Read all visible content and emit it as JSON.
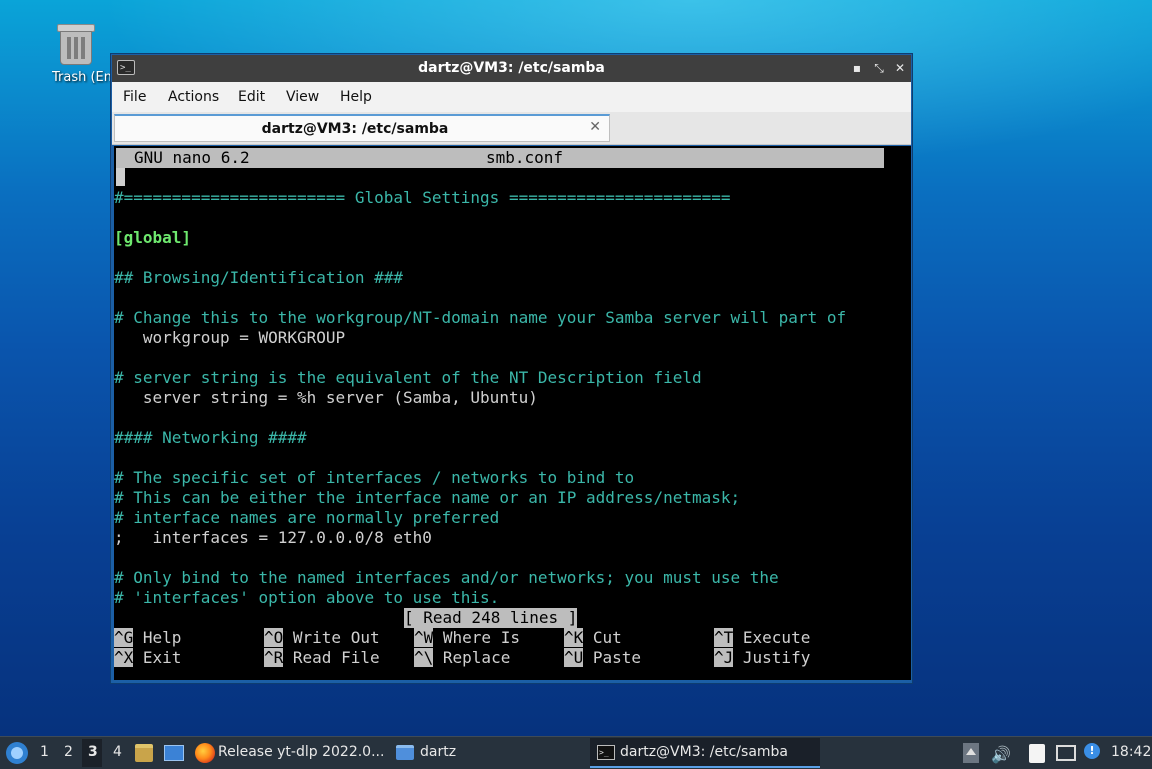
{
  "desktop": {
    "trash_label": "Trash (Empty)"
  },
  "window": {
    "title": "dartz@VM3: /etc/samba",
    "menu": [
      "File",
      "Actions",
      "Edit",
      "View",
      "Help"
    ],
    "tab_title": "dartz@VM3: /etc/samba",
    "controls": {
      "minimize": "▪",
      "maximize": "⤡",
      "close": "✕"
    }
  },
  "nano": {
    "version": "GNU nano 6.2",
    "filename": "smb.conf",
    "lines": [
      {
        "text": "#======================= Global Settings =======================",
        "style": "cyan"
      },
      {
        "text": "",
        "style": "white"
      },
      {
        "text": "[global]",
        "style": "green"
      },
      {
        "text": "",
        "style": "white"
      },
      {
        "text": "## Browsing/Identification ###",
        "style": "cyan"
      },
      {
        "text": "",
        "style": "white"
      },
      {
        "text": "# Change this to the workgroup/NT-domain name your Samba server will part of",
        "style": "cyan"
      },
      {
        "text": "   workgroup = WORKGROUP",
        "style": "white"
      },
      {
        "text": "",
        "style": "white"
      },
      {
        "text": "# server string is the equivalent of the NT Description field",
        "style": "cyan"
      },
      {
        "text": "   server string = %h server (Samba, Ubuntu)",
        "style": "white"
      },
      {
        "text": "",
        "style": "white"
      },
      {
        "text": "#### Networking ####",
        "style": "cyan"
      },
      {
        "text": "",
        "style": "white"
      },
      {
        "text": "# The specific set of interfaces / networks to bind to",
        "style": "cyan"
      },
      {
        "text": "# This can be either the interface name or an IP address/netmask;",
        "style": "cyan"
      },
      {
        "text": "# interface names are normally preferred",
        "style": "cyan"
      },
      {
        "text": ";   interfaces = 127.0.0.0/8 eth0",
        "style": "white"
      },
      {
        "text": "",
        "style": "white"
      },
      {
        "text": "# Only bind to the named interfaces and/or networks; you must use the",
        "style": "cyan"
      },
      {
        "text": "# 'interfaces' option above to use this.",
        "style": "cyan"
      }
    ],
    "status": "[ Read 248 lines ]",
    "shortcuts": [
      [
        {
          "key": "^G",
          "label": "Help"
        },
        {
          "key": "^O",
          "label": "Write Out"
        },
        {
          "key": "^W",
          "label": "Where Is"
        },
        {
          "key": "^K",
          "label": "Cut"
        },
        {
          "key": "^T",
          "label": "Execute"
        }
      ],
      [
        {
          "key": "^X",
          "label": "Exit"
        },
        {
          "key": "^R",
          "label": "Read File"
        },
        {
          "key": "^\\",
          "label": "Replace"
        },
        {
          "key": "^U",
          "label": "Paste"
        },
        {
          "key": "^J",
          "label": "Justify"
        }
      ]
    ]
  },
  "taskbar": {
    "workspaces": [
      "1",
      "2",
      "3",
      "4"
    ],
    "tasks": {
      "firefox": "Release yt-dlp 2022.0...",
      "folder": "dartz",
      "terminal": "dartz@VM3: /etc/samba"
    },
    "clock": "18:42"
  }
}
